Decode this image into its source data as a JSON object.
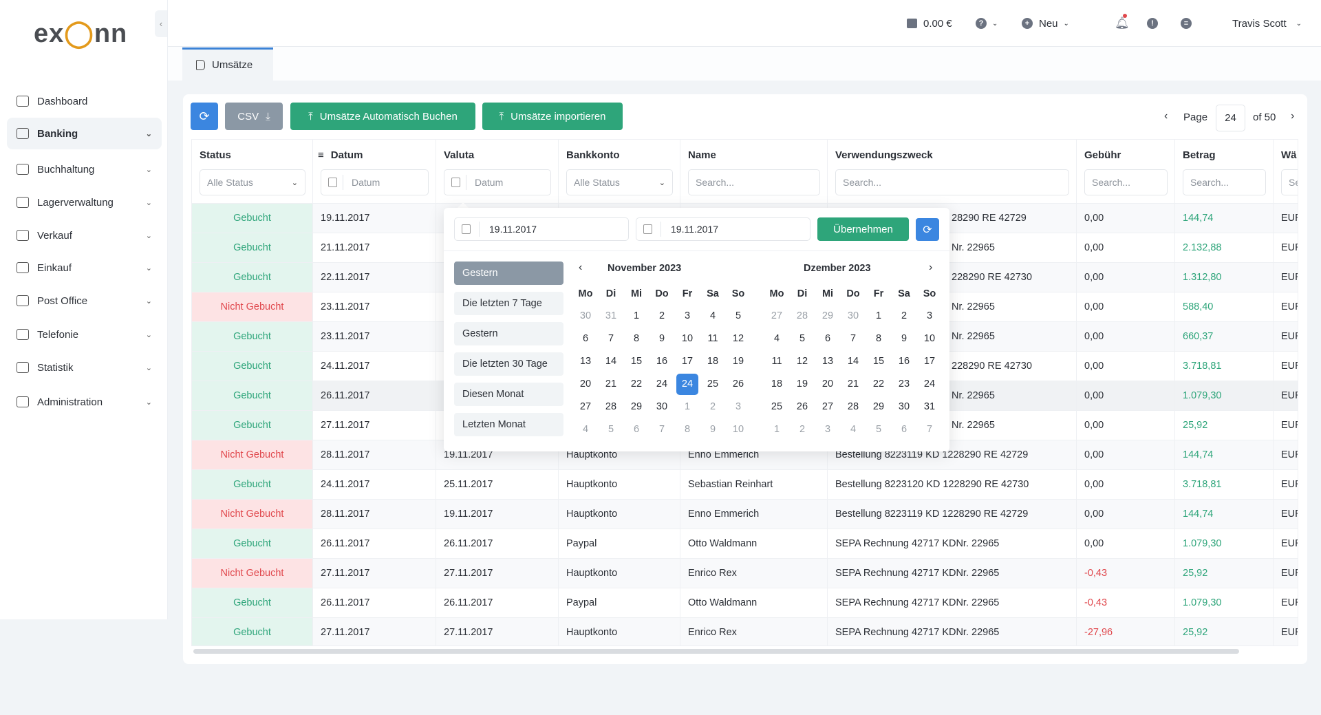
{
  "app": {
    "logo": "exonn"
  },
  "sidebar": {
    "items": [
      {
        "label": "Dashboard",
        "icon": "dashboard-icon",
        "chev": false
      },
      {
        "label": "Banking",
        "icon": "bank-icon",
        "chev": true,
        "active": true
      },
      {
        "label": "Buchhaltung",
        "icon": "ledger-icon",
        "chev": true
      },
      {
        "label": "Lagerverwaltung",
        "icon": "warehouse-icon",
        "chev": true
      },
      {
        "label": "Verkauf",
        "icon": "sales-icon",
        "chev": true
      },
      {
        "label": "Einkauf",
        "icon": "cart-icon",
        "chev": true
      },
      {
        "label": "Post Office",
        "icon": "mail-icon",
        "chev": true
      },
      {
        "label": "Telefonie",
        "icon": "phone-icon",
        "chev": true
      },
      {
        "label": "Statistik",
        "icon": "chart-icon",
        "chev": true
      },
      {
        "label": "Administration",
        "icon": "gear-icon",
        "chev": true
      }
    ]
  },
  "header": {
    "balance": "0.00 €",
    "new_label": "Neu",
    "user": "Travis Scott"
  },
  "tab": {
    "label": "Umsätze"
  },
  "toolbar": {
    "csv": "CSV",
    "auto": "Umsätze Automatisch Buchen",
    "import": "Umsätze importieren"
  },
  "pager": {
    "page_label": "Page",
    "page": "24",
    "of": "of 50"
  },
  "colors": {
    "accent": "#3b86e0",
    "green": "#2ea57a",
    "red": "#e0474c"
  },
  "table": {
    "columns": [
      {
        "label": "Status",
        "filter": "Alle Status",
        "type": "select"
      },
      {
        "label": "Datum",
        "filter": "Datum",
        "type": "date",
        "sort": true
      },
      {
        "label": "Valuta",
        "filter": "Datum",
        "type": "date"
      },
      {
        "label": "Bankkonto",
        "filter": "Alle Status",
        "type": "select"
      },
      {
        "label": "Name",
        "filter": "Search...",
        "type": "text"
      },
      {
        "label": "Verwendungszweck",
        "filter": "Search...",
        "type": "text"
      },
      {
        "label": "Gebühr",
        "filter": "Search...",
        "type": "text"
      },
      {
        "label": "Betrag",
        "filter": "Search...",
        "type": "text"
      },
      {
        "label": "Wä",
        "filter": "Se",
        "type": "text"
      }
    ],
    "rows": [
      {
        "status": "Gebucht",
        "datum": "19.11.2017",
        "valuta": "",
        "konto": "",
        "name": "",
        "zweck": "28290 RE 42729",
        "gebuehr": "0,00",
        "betrag": "144,74",
        "w": "EUR",
        "clip": true
      },
      {
        "status": "Gebucht",
        "datum": "21.11.2017",
        "valuta": "",
        "konto": "",
        "name": "",
        "zweck": "Nr. 22965",
        "gebuehr": "0,00",
        "betrag": "2.132,88",
        "w": "EUR",
        "clip": true
      },
      {
        "status": "Gebucht",
        "datum": "22.11.2017",
        "valuta": "",
        "konto": "",
        "name": "",
        "zweck": "228290 RE 42730",
        "gebuehr": "0,00",
        "betrag": "1.312,80",
        "w": "EUR",
        "clip": true
      },
      {
        "status": "Nicht Gebucht",
        "datum": "23.11.2017",
        "valuta": "",
        "konto": "",
        "name": "",
        "zweck": "Nr. 22965",
        "gebuehr": "0,00",
        "betrag": "588,40",
        "w": "EUR",
        "clip": true
      },
      {
        "status": "Gebucht",
        "datum": "23.11.2017",
        "valuta": "",
        "konto": "",
        "name": "",
        "zweck": "Nr. 22965",
        "gebuehr": "0,00",
        "betrag": "660,37",
        "w": "EUR",
        "clip": true
      },
      {
        "status": "Gebucht",
        "datum": "24.11.2017",
        "valuta": "",
        "konto": "",
        "name": "",
        "zweck": "228290 RE 42730",
        "gebuehr": "0,00",
        "betrag": "3.718,81",
        "w": "EUR",
        "clip": true
      },
      {
        "status": "Gebucht",
        "datum": "26.11.2017",
        "valuta": "",
        "konto": "",
        "name": "",
        "zweck": "Nr. 22965",
        "gebuehr": "0,00",
        "betrag": "1.079,30",
        "w": "EUR",
        "clip": true,
        "hover": true
      },
      {
        "status": "Gebucht",
        "datum": "27.11.2017",
        "valuta": "",
        "konto": "",
        "name": "",
        "zweck": "Nr. 22965",
        "gebuehr": "0,00",
        "betrag": "25,92",
        "w": "EUR",
        "clip": true
      },
      {
        "status": "Nicht Gebucht",
        "datum": "28.11.2017",
        "valuta": "19.11.2017",
        "konto": "Hauptkonto",
        "name": "Enno Emmerich",
        "zweck": "Bestellung 8223119 KD 1228290 RE 42729",
        "gebuehr": "0,00",
        "betrag": "144,74",
        "w": "EUR"
      },
      {
        "status": "Gebucht",
        "datum": "24.11.2017",
        "valuta": "25.11.2017",
        "konto": "Hauptkonto",
        "name": "Sebastian Reinhart",
        "zweck": "Bestellung 8223120 KD 1228290 RE 42730",
        "gebuehr": "0,00",
        "betrag": "3.718,81",
        "w": "EUR"
      },
      {
        "status": "Nicht Gebucht",
        "datum": "28.11.2017",
        "valuta": "19.11.2017",
        "konto": "Hauptkonto",
        "name": "Enno Emmerich",
        "zweck": "Bestellung 8223119 KD 1228290 RE 42729",
        "gebuehr": "0,00",
        "betrag": "144,74",
        "w": "EUR"
      },
      {
        "status": "Gebucht",
        "datum": "26.11.2017",
        "valuta": "26.11.2017",
        "konto": "Paypal",
        "name": "Otto Waldmann",
        "zweck": "SEPA Rechnung 42717 KDNr. 22965",
        "gebuehr": "0,00",
        "betrag": "1.079,30",
        "w": "EUR"
      },
      {
        "status": "Nicht Gebucht",
        "datum": "27.11.2017",
        "valuta": "27.11.2017",
        "konto": "Hauptkonto",
        "name": "Enrico Rex",
        "zweck": "SEPA Rechnung 42717 KDNr. 22965",
        "gebuehr": "-0,43",
        "betrag": "25,92",
        "w": "EUR"
      },
      {
        "status": "Gebucht",
        "datum": "26.11.2017",
        "valuta": "26.11.2017",
        "konto": "Paypal",
        "name": "Otto Waldmann",
        "zweck": "SEPA Rechnung 42717 KDNr. 22965",
        "gebuehr": "-0,43",
        "betrag": "1.079,30",
        "w": "EUR"
      },
      {
        "status": "Gebucht",
        "datum": "27.11.2017",
        "valuta": "27.11.2017",
        "konto": "Hauptkonto",
        "name": "Enrico Rex",
        "zweck": "SEPA Rechnung 42717 KDNr. 22965",
        "gebuehr": "-27,96",
        "betrag": "25,92",
        "w": "EUR"
      }
    ]
  },
  "datepicker": {
    "from": "19.11.2017",
    "to": "19.11.2017",
    "apply": "Übernehmen",
    "presets": [
      "Gestern",
      "Die letzten 7 Tage",
      "Gestern",
      "Die letzten 30 Tage",
      "Diesen Monat",
      "Letzten Monat"
    ],
    "selected_preset": 0,
    "weekdays": [
      "Mo",
      "Di",
      "Mi",
      "Do",
      "Fr",
      "Sa",
      "So"
    ],
    "months": [
      {
        "title": "November 2023",
        "selected": "24",
        "weeks": [
          [
            "30",
            "31",
            "1",
            "2",
            "3",
            "4",
            "5"
          ],
          [
            "6",
            "7",
            "8",
            "9",
            "10",
            "11",
            "12"
          ],
          [
            "13",
            "14",
            "15",
            "16",
            "17",
            "18",
            "19"
          ],
          [
            "20",
            "21",
            "22",
            "24",
            "24",
            "25",
            "26"
          ],
          [
            "27",
            "28",
            "29",
            "30",
            "1",
            "2",
            "3"
          ],
          [
            "4",
            "5",
            "6",
            "7",
            "8",
            "9",
            "10"
          ]
        ]
      },
      {
        "title": "Dzember 2023",
        "weeks": [
          [
            "27",
            "28",
            "29",
            "30",
            "1",
            "2",
            "3"
          ],
          [
            "4",
            "5",
            "6",
            "7",
            "8",
            "9",
            "10"
          ],
          [
            "11",
            "12",
            "13",
            "14",
            "15",
            "16",
            "17"
          ],
          [
            "18",
            "19",
            "20",
            "21",
            "22",
            "23",
            "24"
          ],
          [
            "25",
            "26",
            "27",
            "28",
            "29",
            "30",
            "31"
          ],
          [
            "1",
            "2",
            "3",
            "4",
            "5",
            "6",
            "7"
          ]
        ]
      }
    ]
  }
}
